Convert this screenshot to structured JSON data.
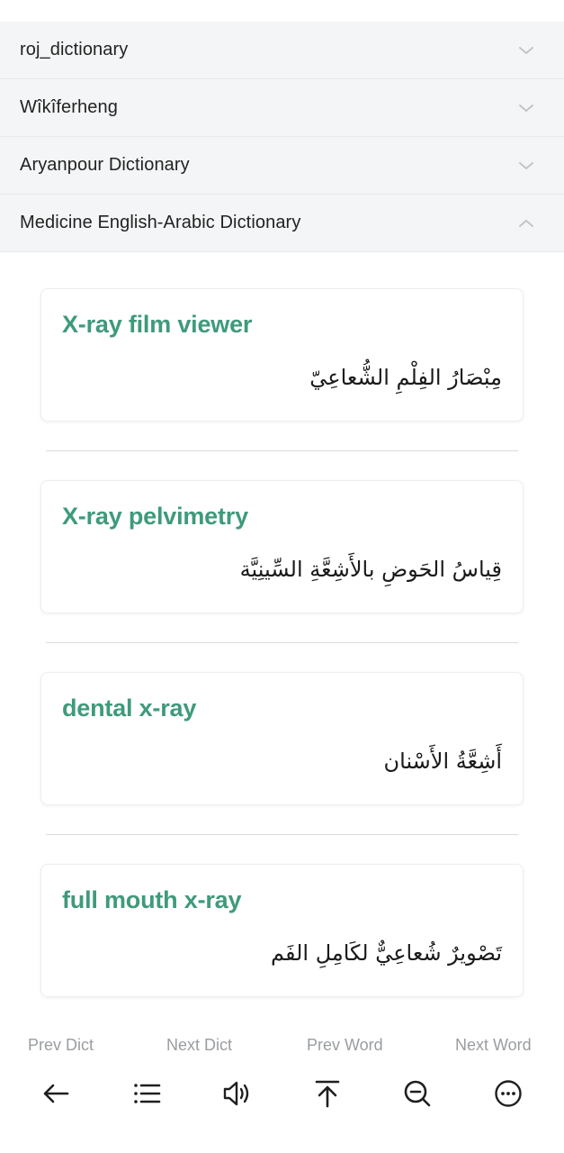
{
  "dictionaries": [
    {
      "label": "roj_dictionary",
      "state": "collapsed",
      "icon": "chevron-down-icon"
    },
    {
      "label": "Wîkîferheng",
      "state": "collapsed",
      "icon": "chevron-down-icon"
    },
    {
      "label": "Aryanpour Dictionary",
      "state": "collapsed",
      "icon": "chevron-down-icon"
    },
    {
      "label": "Medicine English-Arabic Dictionary",
      "state": "expanded",
      "icon": "chevron-up-icon"
    }
  ],
  "entries": [
    {
      "term": "X-ray film viewer",
      "definition": "مِبْصَارُ الفِلْمِ الشُّعاعِيّ"
    },
    {
      "term": "X-ray pelvimetry",
      "definition": "قِياسُ الحَوضِ بالأَشِعَّةِ السِّينِيَّة"
    },
    {
      "term": "dental x-ray",
      "definition": "أَشِعَّةُ الأَسْنان"
    },
    {
      "term": "full mouth x-ray",
      "definition": "تَصْويرٌ شُعاعِيٌّ لكَامِلِ الفَم"
    }
  ],
  "bottom_nav": {
    "prev_dict": "Prev Dict",
    "next_dict": "Next Dict",
    "prev_word": "Prev Word",
    "next_word": "Next Word"
  },
  "toolbar_icons": [
    "back-arrow-icon",
    "list-icon",
    "speaker-icon",
    "scroll-to-top-icon",
    "search-zoom-icon",
    "more-icon"
  ],
  "colors": {
    "accent": "#3f9a7c",
    "accordion_bg": "#f4f5f6",
    "muted_text": "#9a9da1"
  }
}
